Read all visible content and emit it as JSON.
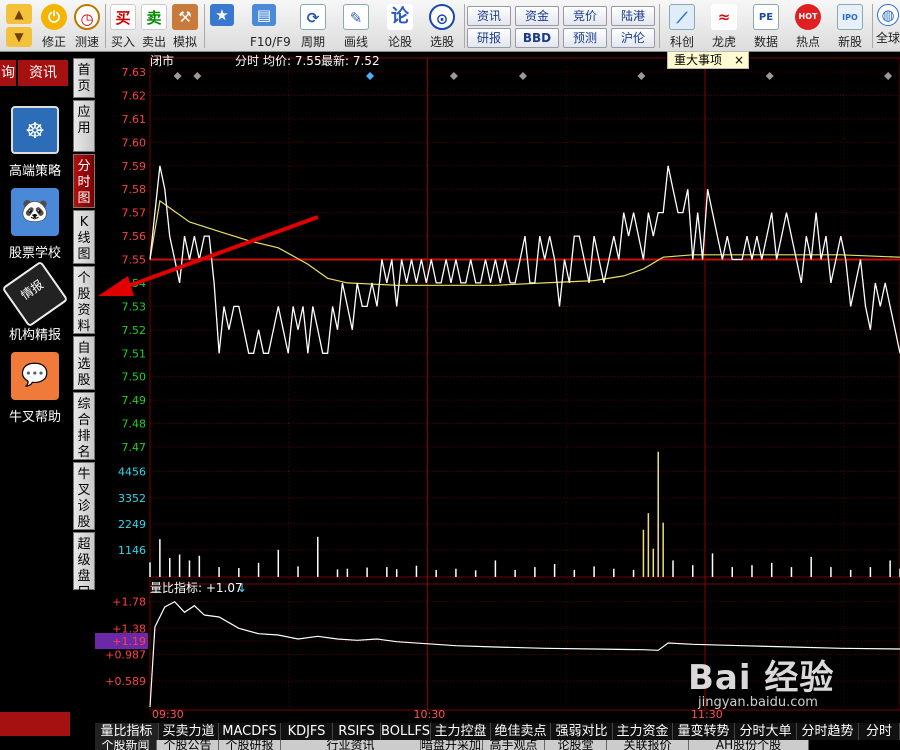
{
  "toolbar": {
    "buttons": [
      {
        "label": "修正",
        "icon": "refresh-icon"
      },
      {
        "label": "测速",
        "icon": "clock-icon"
      },
      {
        "label": "买入",
        "icon": "buy-icon",
        "glyph": "买"
      },
      {
        "label": "卖出",
        "icon": "sell-icon",
        "glyph": "卖"
      },
      {
        "label": "模拟",
        "icon": "hammer-icon"
      },
      {
        "label": "F10/F9",
        "icon": "f10-icon"
      },
      {
        "label": "周期",
        "icon": "period-icon"
      },
      {
        "label": "画线",
        "icon": "pencil-icon"
      },
      {
        "label": "论股",
        "icon": "discuss-icon",
        "glyph": "论"
      },
      {
        "label": "选股",
        "icon": "select-stock-icon"
      },
      {
        "label": "科创",
        "icon": "kechuang-icon"
      },
      {
        "label": "龙虎",
        "icon": "dragon-tiger-icon"
      },
      {
        "label": "数据",
        "icon": "pe-data-icon",
        "glyph": "PE"
      },
      {
        "label": "热点",
        "icon": "hot-icon",
        "glyph": "HOT"
      },
      {
        "label": "新股",
        "icon": "ipo-icon",
        "glyph": "IPO"
      },
      {
        "label": "全球",
        "icon": "globe-icon"
      }
    ],
    "text_buttons": [
      "资讯",
      "资金",
      "竞价",
      "陆港",
      "研报",
      "BBD",
      "预测",
      "沪伦"
    ]
  },
  "leftbar": {
    "tabs": [
      "询",
      "资讯"
    ],
    "items": [
      {
        "label": "高端策略",
        "icon": "brain-icon"
      },
      {
        "label": "股票学校",
        "icon": "school-icon"
      },
      {
        "label": "机构精报",
        "icon": "report-icon",
        "glyph": "情报"
      },
      {
        "label": "牛叉帮助",
        "icon": "help-chat-icon"
      }
    ]
  },
  "vtabs": [
    "首页",
    "应用",
    "分时图",
    "K线图",
    "个股资料",
    "自选股",
    "综合排名",
    "牛叉诊股",
    "超级盘口"
  ],
  "chart": {
    "header": {
      "status": "闭市",
      "name": "分时",
      "avg_label": "均价: 7.55",
      "last_label": "最新: 7.52"
    },
    "notice_label": "重大事项",
    "notice_close": "×",
    "sub_header": "量比指标: +1.07",
    "colors": {
      "price": "#ffffff",
      "avg": "#e8e060",
      "prev_close": "#c81010",
      "grid": "#5a0000",
      "axis_up": "#ff4040",
      "axis_down": "#20d020",
      "volume": "#ffffff"
    }
  },
  "chart_data": {
    "type": "line",
    "series": [],
    "price_axis": {
      "ticks": [
        "7.63",
        "7.62",
        "7.61",
        "7.60",
        "7.59",
        "7.58",
        "7.57",
        "7.56",
        "7.55",
        "7.54",
        "7.53",
        "7.52",
        "7.51",
        "7.50",
        "7.49",
        "7.48",
        "7.47"
      ],
      "ylim": [
        7.47,
        7.63
      ],
      "prev_close": 7.55
    },
    "volume_axis": {
      "ticks": [
        "4456",
        "3352",
        "2249",
        "1146"
      ],
      "ylim": [
        0,
        5500
      ]
    },
    "ratio_axis": {
      "ticks": [
        "+1.78",
        "+1.38",
        "+1.19",
        "+0.987",
        "+0.589"
      ],
      "ylim": [
        0.2,
        1.85
      ]
    },
    "x_ticks": [
      "09:30",
      "10:30",
      "11:30"
    ],
    "price_points": [
      [
        0,
        7.55
      ],
      [
        1,
        7.57
      ],
      [
        2,
        7.59
      ],
      [
        3,
        7.58
      ],
      [
        4,
        7.56
      ],
      [
        5,
        7.55
      ],
      [
        6,
        7.54
      ],
      [
        7,
        7.56
      ],
      [
        8,
        7.55
      ],
      [
        9,
        7.56
      ],
      [
        10,
        7.55
      ],
      [
        11,
        7.56
      ],
      [
        12,
        7.56
      ],
      [
        13,
        7.54
      ],
      [
        14,
        7.51
      ],
      [
        15,
        7.53
      ],
      [
        16,
        7.52
      ],
      [
        17,
        7.53
      ],
      [
        18,
        7.53
      ],
      [
        19,
        7.52
      ],
      [
        20,
        7.51
      ],
      [
        21,
        7.51
      ],
      [
        22,
        7.52
      ],
      [
        23,
        7.51
      ],
      [
        24,
        7.51
      ],
      [
        25,
        7.52
      ],
      [
        26,
        7.53
      ],
      [
        27,
        7.52
      ],
      [
        28,
        7.51
      ],
      [
        29,
        7.53
      ],
      [
        30,
        7.52
      ],
      [
        31,
        7.53
      ],
      [
        32,
        7.51
      ],
      [
        33,
        7.53
      ],
      [
        34,
        7.52
      ],
      [
        35,
        7.51
      ],
      [
        36,
        7.51
      ],
      [
        37,
        7.53
      ],
      [
        38,
        7.52
      ],
      [
        39,
        7.54
      ],
      [
        40,
        7.53
      ],
      [
        41,
        7.52
      ],
      [
        42,
        7.54
      ],
      [
        43,
        7.53
      ],
      [
        44,
        7.53
      ],
      [
        45,
        7.54
      ],
      [
        46,
        7.53
      ],
      [
        47,
        7.55
      ],
      [
        48,
        7.54
      ],
      [
        49,
        7.55
      ],
      [
        50,
        7.53
      ],
      [
        51,
        7.55
      ],
      [
        52,
        7.54
      ],
      [
        53,
        7.55
      ],
      [
        54,
        7.54
      ],
      [
        55,
        7.55
      ],
      [
        56,
        7.54
      ],
      [
        57,
        7.55
      ],
      [
        58,
        7.54
      ],
      [
        59,
        7.54
      ],
      [
        60,
        7.55
      ],
      [
        61,
        7.54
      ],
      [
        62,
        7.55
      ],
      [
        63,
        7.54
      ],
      [
        64,
        7.54
      ],
      [
        65,
        7.55
      ],
      [
        66,
        7.54
      ],
      [
        67,
        7.54
      ],
      [
        68,
        7.55
      ],
      [
        69,
        7.54
      ],
      [
        70,
        7.55
      ],
      [
        71,
        7.54
      ],
      [
        72,
        7.55
      ],
      [
        73,
        7.54
      ],
      [
        74,
        7.54
      ],
      [
        75,
        7.55
      ],
      [
        76,
        7.56
      ],
      [
        77,
        7.54
      ],
      [
        78,
        7.54
      ],
      [
        79,
        7.56
      ],
      [
        80,
        7.55
      ],
      [
        81,
        7.56
      ],
      [
        82,
        7.55
      ],
      [
        83,
        7.53
      ],
      [
        84,
        7.55
      ],
      [
        85,
        7.54
      ],
      [
        86,
        7.56
      ],
      [
        87,
        7.56
      ],
      [
        88,
        7.55
      ],
      [
        89,
        7.54
      ],
      [
        90,
        7.56
      ],
      [
        91,
        7.55
      ],
      [
        92,
        7.54
      ],
      [
        93,
        7.55
      ],
      [
        94,
        7.56
      ],
      [
        95,
        7.55
      ],
      [
        96,
        7.57
      ],
      [
        97,
        7.56
      ],
      [
        98,
        7.57
      ],
      [
        99,
        7.56
      ],
      [
        100,
        7.55
      ],
      [
        101,
        7.57
      ],
      [
        102,
        7.56
      ],
      [
        103,
        7.57
      ],
      [
        104,
        7.57
      ],
      [
        105,
        7.59
      ],
      [
        106,
        7.58
      ],
      [
        107,
        7.57
      ],
      [
        108,
        7.57
      ],
      [
        109,
        7.58
      ],
      [
        110,
        7.55
      ],
      [
        111,
        7.57
      ],
      [
        112,
        7.55
      ],
      [
        113,
        7.58
      ],
      [
        114,
        7.57
      ],
      [
        115,
        7.56
      ],
      [
        116,
        7.55
      ],
      [
        117,
        7.56
      ],
      [
        118,
        7.55
      ],
      [
        119,
        7.55
      ],
      [
        120,
        7.55
      ],
      [
        121,
        7.56
      ],
      [
        122,
        7.55
      ],
      [
        123,
        7.56
      ],
      [
        124,
        7.55
      ],
      [
        125,
        7.56
      ],
      [
        126,
        7.57
      ],
      [
        127,
        7.55
      ],
      [
        128,
        7.56
      ],
      [
        129,
        7.57
      ],
      [
        130,
        7.56
      ],
      [
        131,
        7.55
      ],
      [
        132,
        7.54
      ],
      [
        133,
        7.56
      ],
      [
        134,
        7.55
      ],
      [
        135,
        7.57
      ],
      [
        136,
        7.55
      ],
      [
        137,
        7.56
      ],
      [
        138,
        7.54
      ],
      [
        139,
        7.55
      ],
      [
        140,
        7.56
      ],
      [
        141,
        7.55
      ],
      [
        142,
        7.53
      ],
      [
        143,
        7.54
      ],
      [
        144,
        7.55
      ],
      [
        145,
        7.53
      ],
      [
        146,
        7.52
      ],
      [
        147,
        7.54
      ],
      [
        148,
        7.53
      ],
      [
        149,
        7.54
      ],
      [
        150,
        7.53
      ],
      [
        151,
        7.52
      ],
      [
        152,
        7.51
      ]
    ],
    "avg_points": [
      [
        0,
        7.55
      ],
      [
        2,
        7.575
      ],
      [
        4,
        7.572
      ],
      [
        8,
        7.566
      ],
      [
        14,
        7.562
      ],
      [
        20,
        7.558
      ],
      [
        26,
        7.555
      ],
      [
        32,
        7.548
      ],
      [
        36,
        7.542
      ],
      [
        40,
        7.54
      ],
      [
        50,
        7.539
      ],
      [
        60,
        7.539
      ],
      [
        70,
        7.539
      ],
      [
        80,
        7.54
      ],
      [
        90,
        7.541
      ],
      [
        96,
        7.543
      ],
      [
        100,
        7.546
      ],
      [
        104,
        7.551
      ],
      [
        110,
        7.552
      ],
      [
        120,
        7.552
      ],
      [
        130,
        7.552
      ],
      [
        140,
        7.552
      ],
      [
        152,
        7.551
      ]
    ],
    "volume_bars": [
      [
        0,
        620
      ],
      [
        2,
        1600
      ],
      [
        4,
        800
      ],
      [
        6,
        950
      ],
      [
        8,
        700
      ],
      [
        10,
        900
      ],
      [
        14,
        420
      ],
      [
        18,
        380
      ],
      [
        22,
        600
      ],
      [
        26,
        1150
      ],
      [
        30,
        450
      ],
      [
        34,
        1700
      ],
      [
        38,
        320
      ],
      [
        40,
        350
      ],
      [
        44,
        400
      ],
      [
        48,
        420
      ],
      [
        50,
        330
      ],
      [
        54,
        480
      ],
      [
        58,
        300
      ],
      [
        62,
        350
      ],
      [
        66,
        280
      ],
      [
        70,
        700
      ],
      [
        74,
        300
      ],
      [
        78,
        420
      ],
      [
        82,
        550
      ],
      [
        86,
        300
      ],
      [
        90,
        450
      ],
      [
        94,
        350
      ],
      [
        98,
        300
      ],
      [
        100,
        2000
      ],
      [
        101,
        2700
      ],
      [
        102,
        1200
      ],
      [
        103,
        5300
      ],
      [
        104,
        2300
      ],
      [
        106,
        700
      ],
      [
        110,
        500
      ],
      [
        114,
        1000
      ],
      [
        118,
        420
      ],
      [
        122,
        500
      ],
      [
        126,
        600
      ],
      [
        130,
        420
      ],
      [
        134,
        850
      ],
      [
        138,
        420
      ],
      [
        142,
        300
      ],
      [
        146,
        420
      ],
      [
        150,
        700
      ],
      [
        152,
        350
      ]
    ],
    "ratio_points": [
      [
        0,
        0.2
      ],
      [
        1,
        1.4
      ],
      [
        3,
        1.7
      ],
      [
        5,
        1.78
      ],
      [
        7,
        1.62
      ],
      [
        9,
        1.72
      ],
      [
        11,
        1.58
      ],
      [
        14,
        1.55
      ],
      [
        18,
        1.38
      ],
      [
        22,
        1.3
      ],
      [
        26,
        1.28
      ],
      [
        30,
        1.22
      ],
      [
        34,
        1.26
      ],
      [
        38,
        1.22
      ],
      [
        42,
        1.2
      ],
      [
        46,
        1.22
      ],
      [
        50,
        1.18
      ],
      [
        56,
        1.15
      ],
      [
        62,
        1.12
      ],
      [
        70,
        1.1
      ],
      [
        80,
        1.08
      ],
      [
        90,
        1.07
      ],
      [
        100,
        1.06
      ],
      [
        103,
        1.05
      ],
      [
        105,
        1.16
      ],
      [
        110,
        1.14
      ],
      [
        120,
        1.12
      ],
      [
        130,
        1.1
      ],
      [
        140,
        1.08
      ],
      [
        152,
        1.07
      ]
    ]
  },
  "bottom_tabs": {
    "row1": [
      "量比指标",
      "买卖力道",
      "MACDFS",
      "KDJFS",
      "RSIFS",
      "BOLLFS",
      "主力控盘",
      "绝佳卖点",
      "强弱对比",
      "主力资金",
      "量变转势",
      "分时大单",
      "分时趋势",
      "分时"
    ],
    "row2": [
      "个股新闻",
      "个股公告",
      "个股研报",
      "行业资讯",
      "暗盘开采加工",
      "高手观点",
      "论股堂",
      "关联报价",
      "AH股份个股"
    ]
  },
  "watermark": {
    "main": "Bai 经验",
    "sub": "jingyan.baidu.com"
  }
}
